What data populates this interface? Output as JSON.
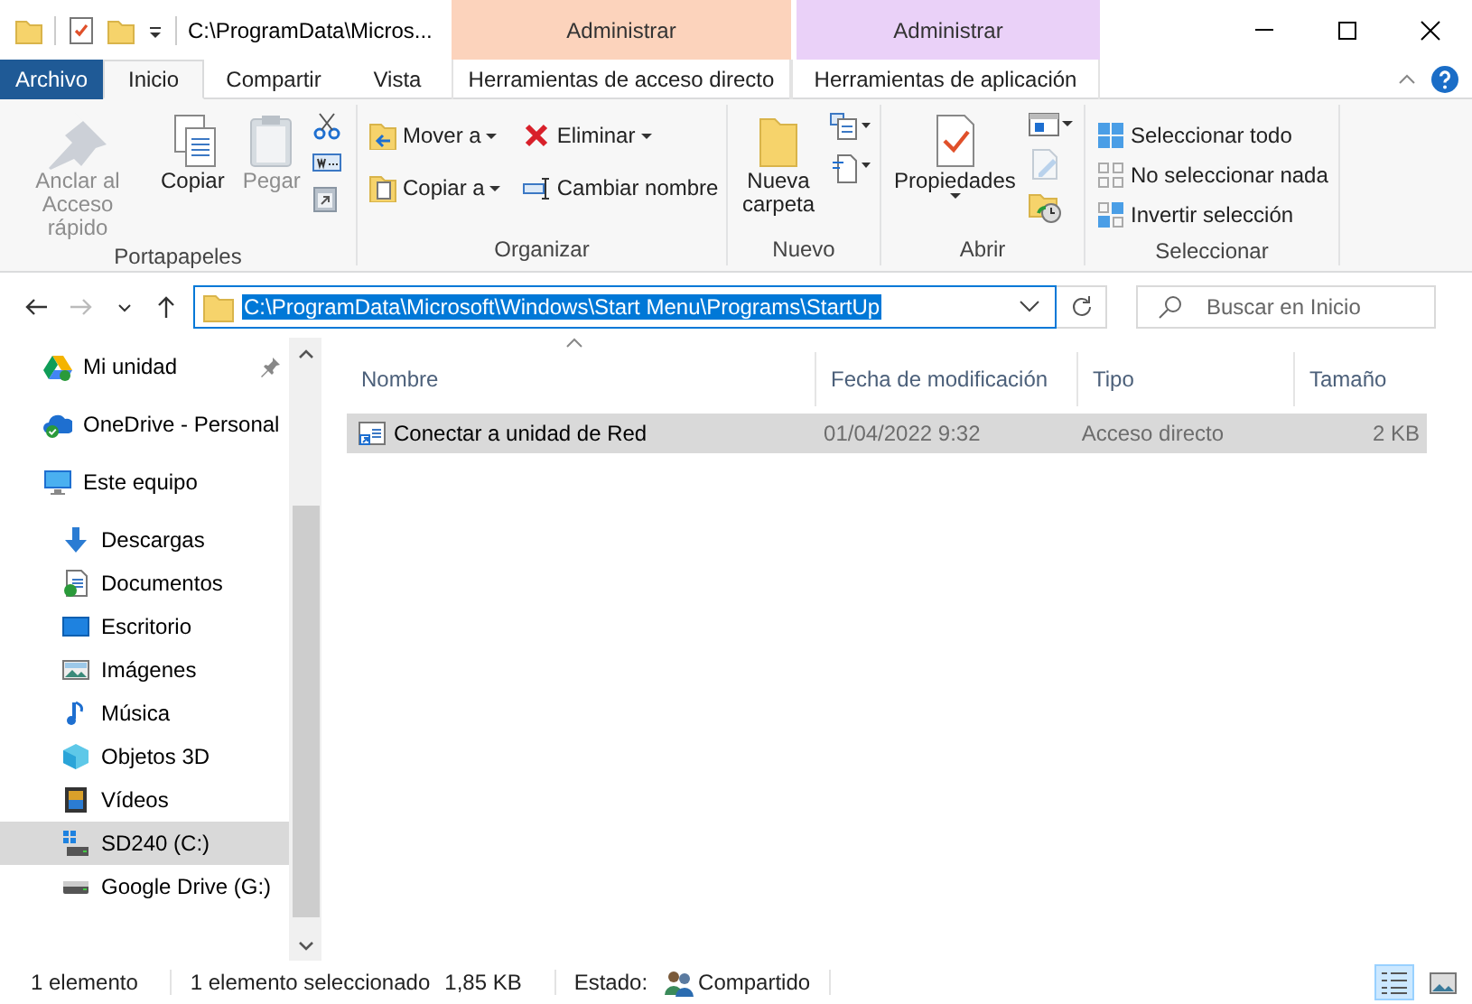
{
  "window": {
    "title": "C:\\ProgramData\\Micros..."
  },
  "context_tabs": [
    {
      "label": "Administrar",
      "color": "#fcd3bc"
    },
    {
      "label": "Administrar",
      "color": "#ead1f8"
    }
  ],
  "ribbon_tabs": [
    {
      "label": "Archivo",
      "kind": "file",
      "selected": false
    },
    {
      "label": "Inicio",
      "kind": "tab",
      "selected": true
    },
    {
      "label": "Compartir",
      "kind": "tab",
      "selected": false
    },
    {
      "label": "Vista",
      "kind": "tab",
      "selected": false
    },
    {
      "label": "Herramientas de acceso directo",
      "kind": "context",
      "selected": false
    },
    {
      "label": "Herramientas de aplicación",
      "kind": "context",
      "selected": false
    }
  ],
  "ribbon_groups": [
    {
      "label": "Portapapeles",
      "commands": [
        {
          "label": "Anclar al Acceso rápido",
          "kind": "large",
          "disabled": true,
          "dropdown": false
        },
        {
          "label": "Copiar",
          "kind": "large",
          "disabled": false,
          "dropdown": false
        },
        {
          "label": "Pegar",
          "kind": "large",
          "disabled": true,
          "dropdown": false
        }
      ]
    },
    {
      "label": "Organizar",
      "commands": [
        {
          "label": "Mover a",
          "kind": "small",
          "disabled": false,
          "dropdown": true
        },
        {
          "label": "Copiar a",
          "kind": "small",
          "disabled": false,
          "dropdown": true
        },
        {
          "label": "Eliminar",
          "kind": "small",
          "disabled": false,
          "dropdown": true
        },
        {
          "label": "Cambiar nombre",
          "kind": "small",
          "disabled": false,
          "dropdown": false
        }
      ]
    },
    {
      "label": "Nuevo",
      "commands": [
        {
          "label": "Nueva carpeta",
          "kind": "large",
          "disabled": false,
          "dropdown": false
        }
      ]
    },
    {
      "label": "Abrir",
      "commands": [
        {
          "label": "Propiedades",
          "kind": "large",
          "disabled": false,
          "dropdown": true
        }
      ]
    },
    {
      "label": "Seleccionar",
      "commands": [
        {
          "label": "Seleccionar todo",
          "kind": "small",
          "disabled": false,
          "dropdown": false
        },
        {
          "label": "No seleccionar nada",
          "kind": "small",
          "disabled": false,
          "dropdown": false
        },
        {
          "label": "Invertir selección",
          "kind": "small",
          "disabled": false,
          "dropdown": false
        }
      ]
    }
  ],
  "address": {
    "value": "C:\\ProgramData\\Microsoft\\Windows\\Start Menu\\Programs\\StartUp",
    "text_selected": true
  },
  "search": {
    "placeholder": "Buscar en Inicio"
  },
  "navigation": [
    {
      "label": "Mi unidad",
      "kind": "gdrive",
      "pinned": true,
      "selected": false
    },
    {
      "label": "OneDrive - Personal",
      "kind": "onedrive",
      "pinned": false,
      "selected": false
    },
    {
      "label": "Este equipo",
      "kind": "pc",
      "pinned": false,
      "selected": false,
      "children": [
        {
          "label": "Descargas",
          "kind": "downloads",
          "pinned": false,
          "selected": false
        },
        {
          "label": "Documentos",
          "kind": "documents",
          "pinned": false,
          "selected": false
        },
        {
          "label": "Escritorio",
          "kind": "desktop",
          "pinned": false,
          "selected": false
        },
        {
          "label": "Imágenes",
          "kind": "pictures",
          "pinned": false,
          "selected": false
        },
        {
          "label": "Música",
          "kind": "music",
          "pinned": false,
          "selected": false
        },
        {
          "label": "Objetos 3D",
          "kind": "objects3d",
          "pinned": false,
          "selected": false
        },
        {
          "label": "Vídeos",
          "kind": "videos",
          "pinned": false,
          "selected": false
        },
        {
          "label": "SD240 (C:)",
          "kind": "system_disk",
          "pinned": false,
          "selected": true
        },
        {
          "label": "Google Drive (G:)",
          "kind": "disk",
          "pinned": false,
          "selected": false
        }
      ]
    }
  ],
  "files": {
    "columns": [
      "Nombre",
      "Fecha de modificación",
      "Tipo",
      "Tamaño"
    ],
    "rows": [
      {
        "cells": [
          "Conectar a unidad de Red",
          "01/04/2022 9:32",
          "Acceso directo",
          "2 KB"
        ],
        "selected": true
      }
    ]
  },
  "status_bar": {
    "items": [
      "1 elemento",
      "1 elemento seleccionado",
      "1,85 KB"
    ],
    "state_label": "Estado:",
    "state_value": "Compartido",
    "view_buttons": [
      {
        "kind": "details",
        "selected": true
      },
      {
        "kind": "thumbnails",
        "selected": false
      }
    ]
  }
}
